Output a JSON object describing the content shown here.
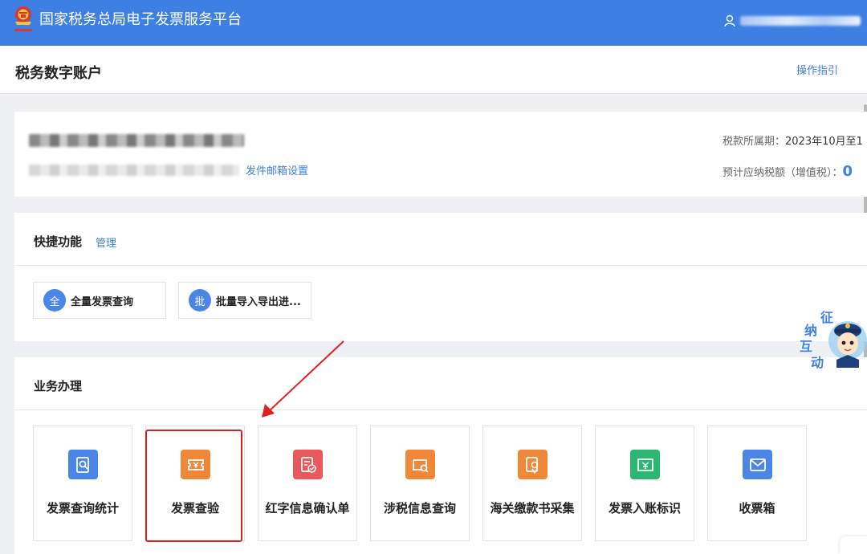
{
  "header": {
    "app_title": "国家税务总局电子发票服务平台",
    "emblem_icon": "tax-emblem-icon",
    "user_icon": "user-icon",
    "bg_color": "#3d7fe3"
  },
  "page": {
    "title": "税务数字账户",
    "guide_link": "操作指引"
  },
  "account": {
    "mailbox_link": "发件邮箱设置",
    "tax_period_label": "税款所属期：",
    "tax_period_value": "2023年10月至1",
    "estimate_label": "预计应纳税额（增值税）：",
    "estimate_value": "0"
  },
  "quick": {
    "title": "快捷功能",
    "manage_link": "管理",
    "items": [
      {
        "badge": "全",
        "label": "全量发票查询"
      },
      {
        "badge": "批",
        "label": "批量导入导出进..."
      }
    ]
  },
  "business": {
    "title": "业务办理",
    "tiles": [
      {
        "label": "发票查询统计",
        "icon": "invoice-search-icon",
        "color": "#4a86e8"
      },
      {
        "label": "发票查验",
        "icon": "invoice-verify-icon",
        "color": "#f0883a"
      },
      {
        "label": "红字信息确认单",
        "icon": "red-letter-confirm-icon",
        "color": "#e9585a"
      },
      {
        "label": "涉税信息查询",
        "icon": "tax-info-search-icon",
        "color": "#f0883a"
      },
      {
        "label": "海关缴款书采集",
        "icon": "customs-payment-icon",
        "color": "#f0883a"
      },
      {
        "label": "发票入账标识",
        "icon": "invoice-booking-icon",
        "color": "#2bb673"
      },
      {
        "label": "收票箱",
        "icon": "invoice-inbox-icon",
        "color": "#4a86e8"
      }
    ]
  },
  "assistant": {
    "chars": [
      "征",
      "纳",
      "互",
      "动"
    ]
  }
}
